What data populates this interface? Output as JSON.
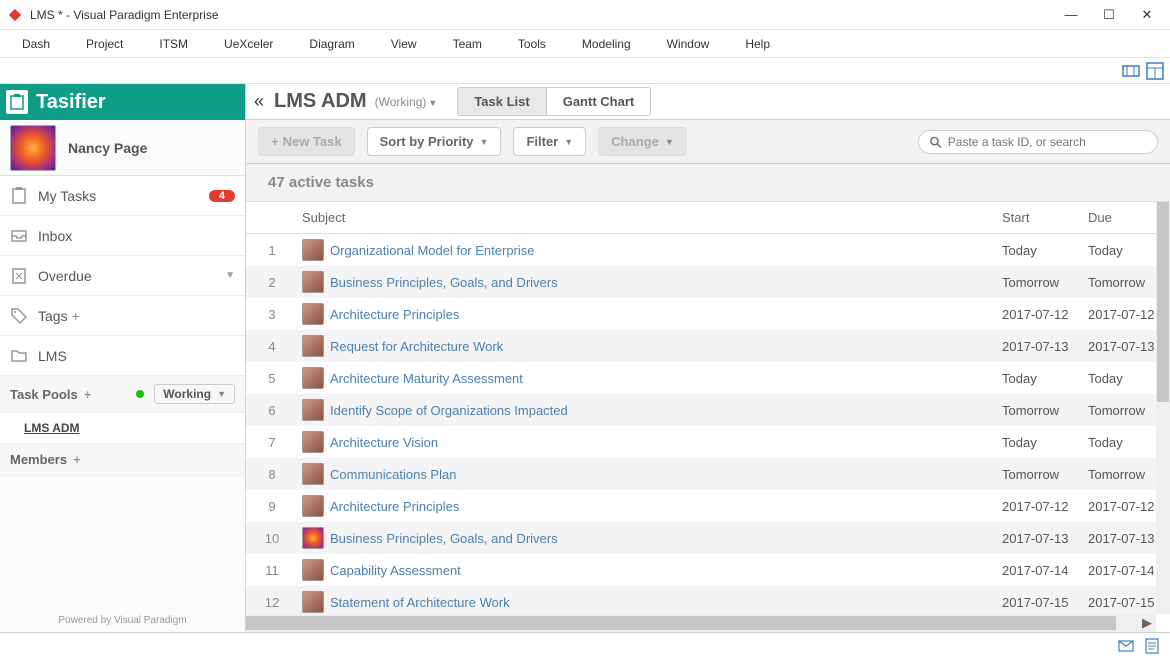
{
  "window": {
    "title": "LMS * - Visual Paradigm Enterprise"
  },
  "menu": [
    "Dash",
    "Project",
    "ITSM",
    "UeXceler",
    "Diagram",
    "View",
    "Team",
    "Tools",
    "Modeling",
    "Window",
    "Help"
  ],
  "sidebar": {
    "brand": "Tasifier",
    "user": "Nancy Page",
    "nav": {
      "my_tasks": "My Tasks",
      "my_tasks_badge": "4",
      "inbox": "Inbox",
      "overdue": "Overdue",
      "tags": "Tags",
      "lms": "LMS"
    },
    "pools_header": "Task Pools",
    "working_filter": "Working",
    "pool": "LMS ADM",
    "members_header": "Members",
    "powered": "Powered by Visual Paradigm"
  },
  "header": {
    "title": "LMS ADM",
    "status": "(Working)",
    "tabs": {
      "task_list": "Task List",
      "gantt": "Gantt Chart"
    }
  },
  "actions": {
    "new_task": "New Task",
    "sort": "Sort by Priority",
    "filter": "Filter",
    "change": "Change"
  },
  "search": {
    "placeholder": "Paste a task ID, or search"
  },
  "summary": "47 active tasks",
  "columns": {
    "subject": "Subject",
    "start": "Start",
    "due": "Due"
  },
  "rows": [
    {
      "n": "1",
      "subject": "Organizational Model for Enterprise",
      "start": "Today",
      "due": "Today",
      "avatar": "person"
    },
    {
      "n": "2",
      "subject": "Business Principles, Goals, and Drivers",
      "start": "Tomorrow",
      "due": "Tomorrow",
      "avatar": "person"
    },
    {
      "n": "3",
      "subject": "Architecture Principles",
      "start": "2017-07-12",
      "due": "2017-07-12",
      "avatar": "person"
    },
    {
      "n": "4",
      "subject": "Request for Architecture Work",
      "start": "2017-07-13",
      "due": "2017-07-13",
      "avatar": "person"
    },
    {
      "n": "5",
      "subject": "Architecture Maturity Assessment",
      "start": "Today",
      "due": "Today",
      "avatar": "person"
    },
    {
      "n": "6",
      "subject": "Identify Scope of Organizations Impacted",
      "start": "Tomorrow",
      "due": "Tomorrow",
      "avatar": "person"
    },
    {
      "n": "7",
      "subject": "Architecture Vision",
      "start": "Today",
      "due": "Today",
      "avatar": "person"
    },
    {
      "n": "8",
      "subject": "Communications Plan",
      "start": "Tomorrow",
      "due": "Tomorrow",
      "avatar": "person"
    },
    {
      "n": "9",
      "subject": "Architecture Principles",
      "start": "2017-07-12",
      "due": "2017-07-12",
      "avatar": "person"
    },
    {
      "n": "10",
      "subject": "Business Principles, Goals, and Drivers",
      "start": "2017-07-13",
      "due": "2017-07-13",
      "avatar": "flower"
    },
    {
      "n": "11",
      "subject": "Capability Assessment",
      "start": "2017-07-14",
      "due": "2017-07-14",
      "avatar": "person"
    },
    {
      "n": "12",
      "subject": "Statement of Architecture Work",
      "start": "2017-07-15",
      "due": "2017-07-15",
      "avatar": "person"
    }
  ]
}
